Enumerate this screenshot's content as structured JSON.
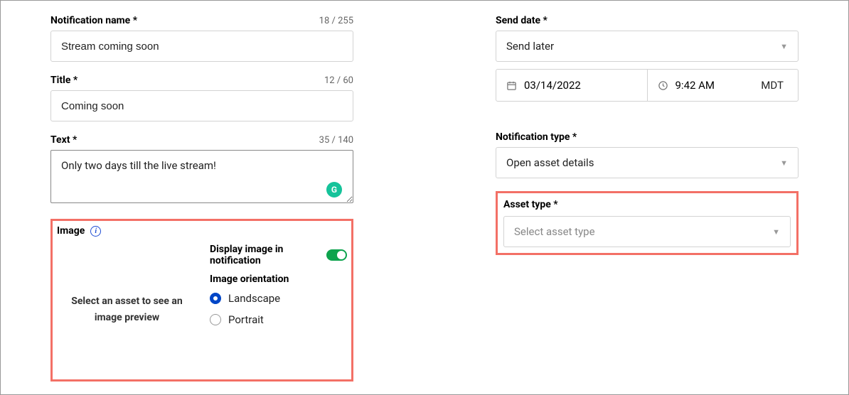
{
  "left": {
    "name_label": "Notification name *",
    "name_counter": "18 / 255",
    "name_value": "Stream coming soon",
    "title_label": "Title *",
    "title_counter": "12 / 60",
    "title_value": "Coming soon",
    "text_label": "Text *",
    "text_counter": "35 / 140",
    "text_value": "Only two days till the live stream!",
    "image_label": "Image",
    "preview_text": "Select an asset to see an image preview",
    "display_toggle_label": "Display image in notification",
    "orientation_label": "Image orientation",
    "orientation_options": {
      "landscape": "Landscape",
      "portrait": "Portrait"
    }
  },
  "right": {
    "send_date_label": "Send date *",
    "send_option": "Send later",
    "date_value": "03/14/2022",
    "time_value": "9:42 AM",
    "timezone": "MDT",
    "notif_type_label": "Notification type *",
    "notif_type_value": "Open asset details",
    "asset_type_label": "Asset type *",
    "asset_type_placeholder": "Select asset type"
  }
}
